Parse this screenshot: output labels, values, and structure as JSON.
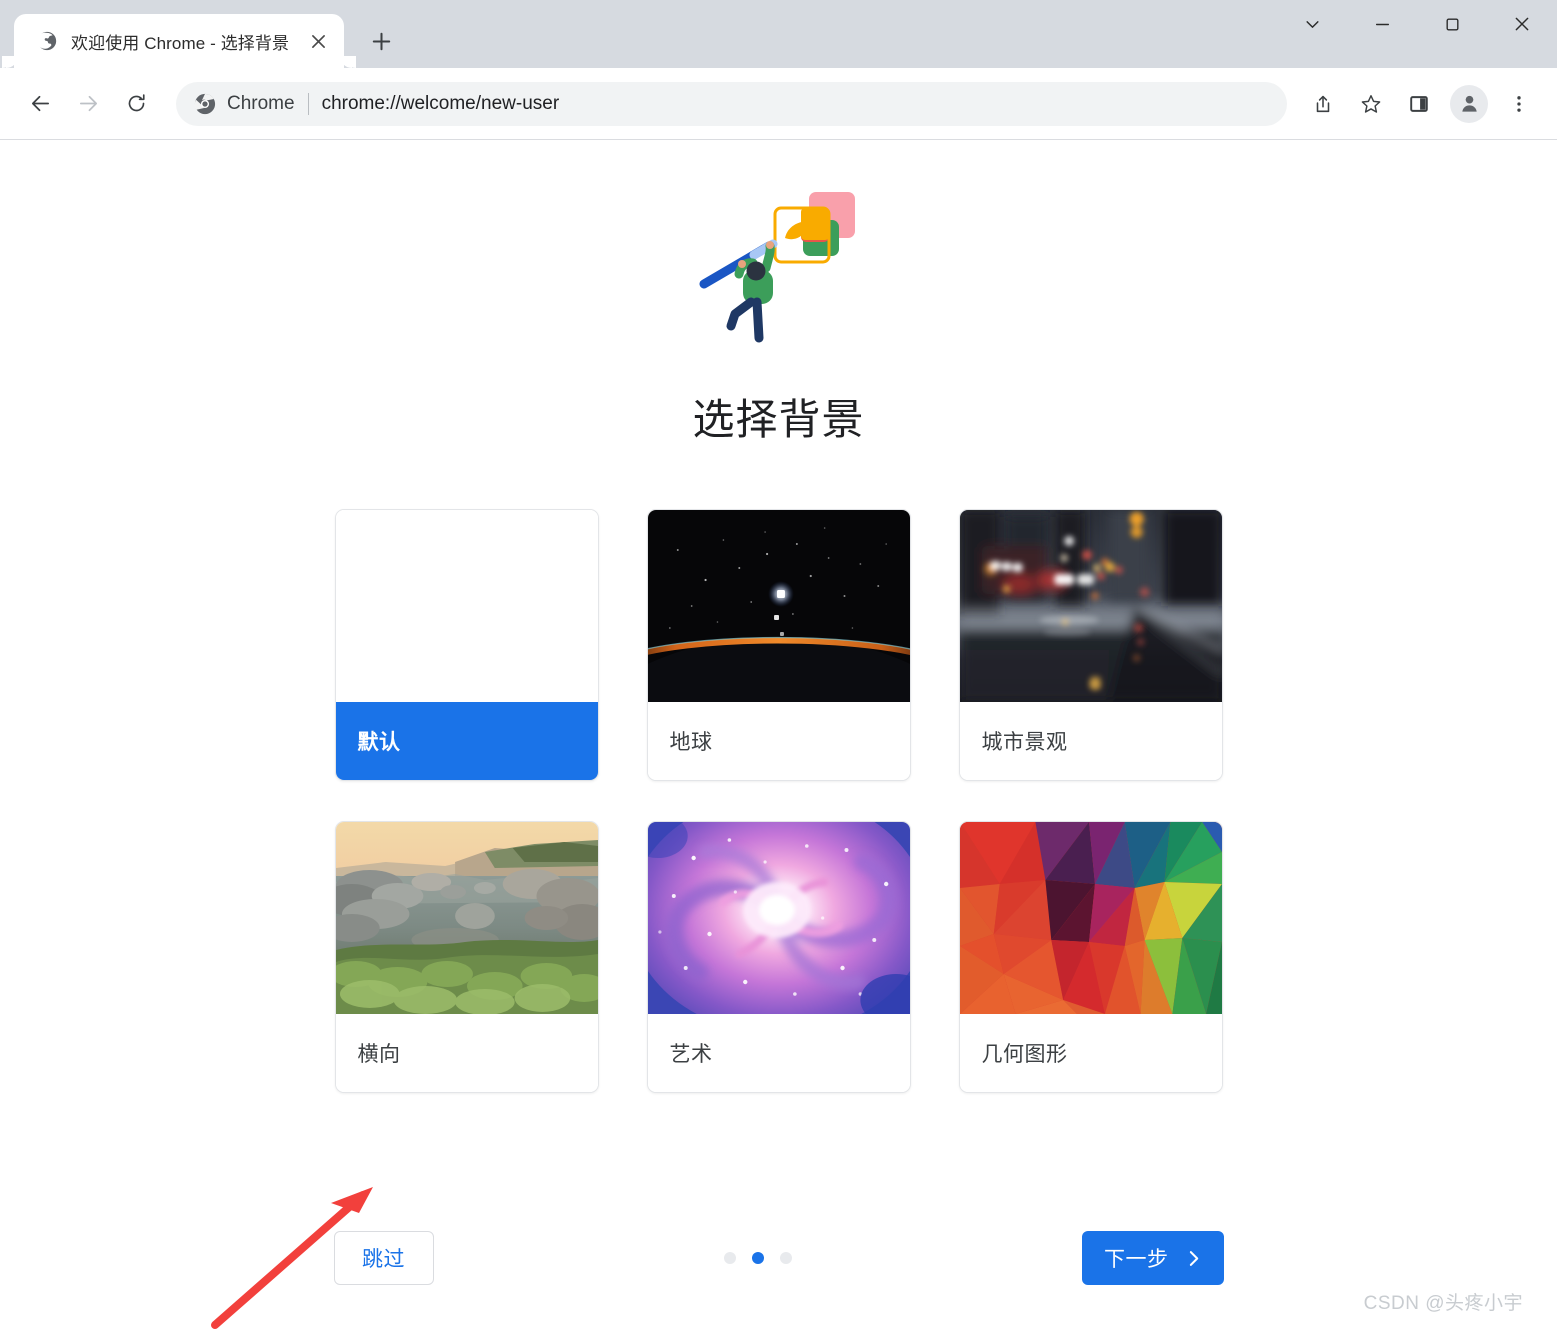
{
  "window": {
    "controls": [
      {
        "name": "tab-search-chevron",
        "icon": "chevron-down-icon"
      },
      {
        "name": "minimize",
        "icon": "minimize-icon"
      },
      {
        "name": "maximize",
        "icon": "maximize-icon"
      },
      {
        "name": "close",
        "icon": "close-icon"
      }
    ]
  },
  "tab": {
    "title": "欢迎使用 Chrome - 选择背景",
    "favicon": "globe-icon",
    "close_icon": "close-icon",
    "new_tab_icon": "plus-icon"
  },
  "toolbar": {
    "back_icon": "arrow-left-icon",
    "forward_icon": "arrow-right-icon",
    "reload_icon": "reload-icon",
    "omnibox": {
      "badge_label": "Chrome",
      "badge_icon": "chrome-logo-icon",
      "url": "chrome://welcome/new-user",
      "scheme": "chrome://",
      "path": "welcome/new-user"
    },
    "share_icon": "share-icon",
    "bookmark_icon": "star-icon",
    "side_panel_icon": "side-panel-icon",
    "profile_icon": "person-avatar-icon",
    "menu_icon": "three-dot-menu-icon"
  },
  "main": {
    "hero_illustration": "person-painting-illustration",
    "title": "选择背景",
    "cards": [
      {
        "label": "默认",
        "thumb": "blank-white",
        "selected": true
      },
      {
        "label": "地球",
        "thumb": "earth-space",
        "selected": false
      },
      {
        "label": "城市景观",
        "thumb": "city-rainy-night",
        "selected": false
      },
      {
        "label": "横向",
        "thumb": "coastal-landscape",
        "selected": false
      },
      {
        "label": "艺术",
        "thumb": "spiral-galaxy",
        "selected": false
      },
      {
        "label": "几何图形",
        "thumb": "low-poly-triangles",
        "selected": false
      }
    ]
  },
  "footer": {
    "skip_label": "跳过",
    "next_label": "下一步",
    "next_icon": "chevron-right-icon",
    "pager": {
      "total": 3,
      "active_index": 1
    }
  },
  "annotation": {
    "arrow_color": "#f2403c",
    "points_to": "跳过"
  },
  "watermark": "CSDN @头疼小宇",
  "colors": {
    "accent_blue": "#1a73e8",
    "titlebar": "#d6dae0",
    "omnibox_bg": "#f1f3f4",
    "text_primary": "#202124",
    "text_secondary": "#3c4043"
  }
}
